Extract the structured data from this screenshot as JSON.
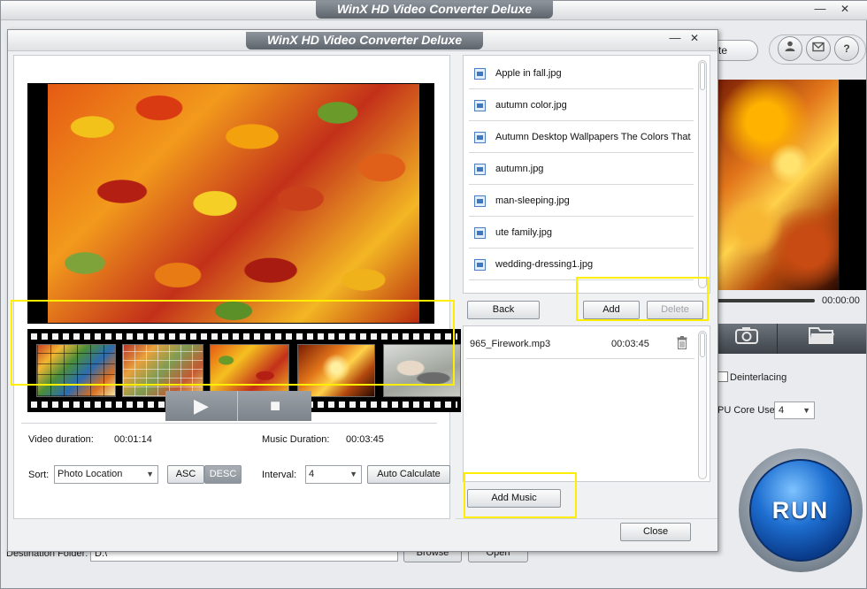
{
  "background": {
    "title": "WinX HD Video Converter Deluxe",
    "minimize": "—",
    "close": "✕",
    "pill_text": "te",
    "help_label": "?",
    "preview_time": "00:00:00",
    "deinterlacing_label": "Deinterlacing",
    "cpu_core_label": "PU Core Use:",
    "cpu_core_value": "4",
    "run_label": "RUN",
    "destination_label": "Destination Folder:",
    "destination_value": "D:\\",
    "browse_label": "Browse",
    "open_label": "Open"
  },
  "dialog": {
    "title": "WinX HD Video Converter Deluxe",
    "minimize": "—",
    "close": "✕",
    "play_icon": "▶",
    "stop_icon": "■",
    "video_duration_label": "Video duration:",
    "video_duration_value": "00:01:14",
    "music_duration_label": "Music Duration:",
    "music_duration_value": "00:03:45",
    "sort_label": "Sort:",
    "sort_value": "Photo Location",
    "asc_label": "ASC",
    "desc_label": "DESC",
    "interval_label": "Interval:",
    "interval_value": "4",
    "auto_calculate_label": "Auto Calculate",
    "files": [
      "Apple in fall.jpg",
      "autumn color.jpg",
      "Autumn Desktop Wallpapers The Colors That",
      "autumn.jpg",
      "man-sleeping.jpg",
      "ute family.jpg",
      "wedding-dressing1.jpg"
    ],
    "back_label": "Back",
    "add_label": "Add",
    "delete_label": "Delete",
    "music": {
      "name": "965_Firework.mp3",
      "duration": "00:03:45"
    },
    "add_music_label": "Add Music",
    "close_label": "Close"
  }
}
